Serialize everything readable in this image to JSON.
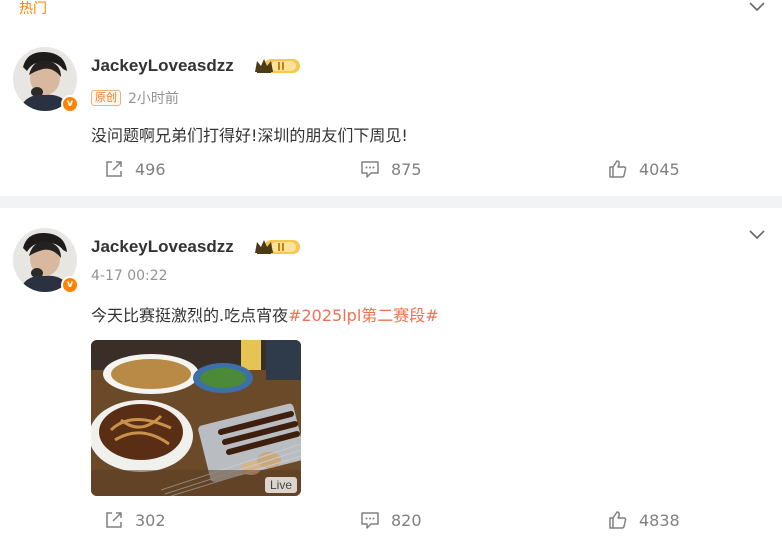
{
  "section": {
    "label": "热门"
  },
  "posts": [
    {
      "username": "JackeyLoveasdzz",
      "original_tag": "原创",
      "time": "2小时前",
      "text": "没问题啊兄弟们打得好!深圳的朋友们下周见!",
      "verified_mark": "v",
      "reposts": "496",
      "comments": "875",
      "likes": "4045"
    },
    {
      "username": "JackeyLoveasdzz",
      "time": "4-17 00:22",
      "text": "今天比赛挺激烈的.吃点宵夜",
      "hashtag": "#2025lpl第二赛段#",
      "verified_mark": "v",
      "image_badge": "Live",
      "reposts": "302",
      "comments": "820",
      "likes": "4838"
    }
  ],
  "colors": {
    "brand_orange": "#ff8200",
    "hashtag": "#eb7350",
    "icon_gray": "#808080",
    "separator": "#f2f3f5"
  },
  "icons": [
    "chevron-down-icon",
    "repost-icon",
    "comment-icon",
    "like-icon",
    "verified-icon",
    "crown-icon"
  ]
}
